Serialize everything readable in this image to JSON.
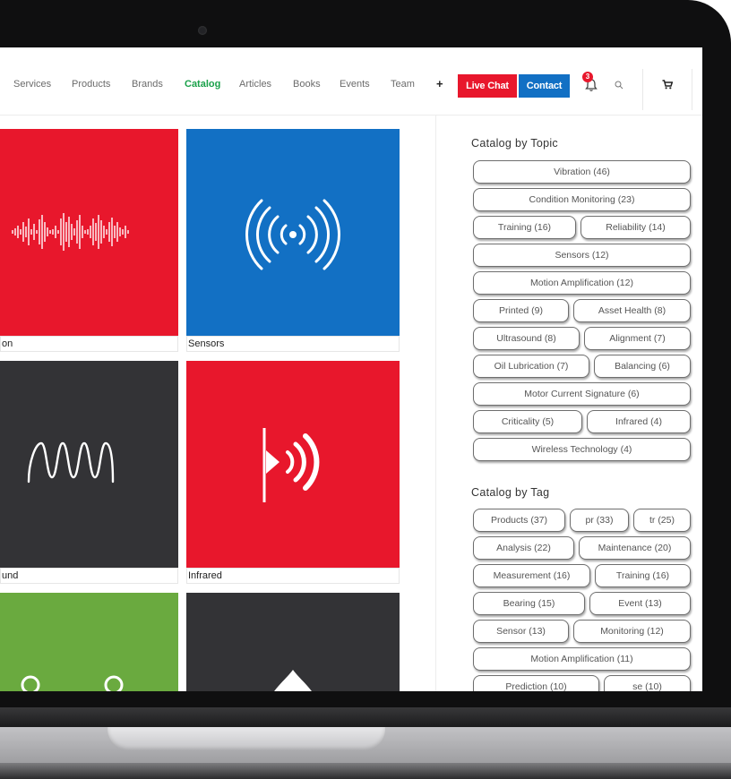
{
  "nav": {
    "items": [
      {
        "label": "Services",
        "active": false
      },
      {
        "label": "Products",
        "active": false
      },
      {
        "label": "Brands",
        "active": false
      },
      {
        "label": "Catalog",
        "active": true
      },
      {
        "label": "Articles",
        "active": false
      },
      {
        "label": "Books",
        "active": false
      },
      {
        "label": "Events",
        "active": false
      },
      {
        "label": "Team",
        "active": false
      }
    ],
    "more": "+",
    "live_chat": "Live Chat",
    "contact": "Contact",
    "notification_count": "3",
    "icons": {
      "bell": "bell-icon",
      "search": "search-icon",
      "cart": "cart-icon"
    }
  },
  "colors": {
    "brand_red": "#e8172c",
    "brand_blue": "#1270c4",
    "nav_active": "#1aa14a",
    "tile_dark": "#333336",
    "tile_green": "#6aaa3f"
  },
  "tiles": [
    {
      "label": "on",
      "icon": "soundwave-icon",
      "color": "#e8172c"
    },
    {
      "label": "Sensors",
      "icon": "wireless-signal-icon",
      "color": "#1270c4"
    },
    {
      "label": "und",
      "icon": "ultrasound-wave-icon",
      "color": "#333336"
    },
    {
      "label": "Infrared",
      "icon": "infrared-icon",
      "color": "#e8172c"
    },
    {
      "label": "",
      "icon": "rings-icon",
      "color": "#6aaa3f"
    },
    {
      "label": "",
      "icon": "oil-drop-icon",
      "color": "#333336"
    }
  ],
  "sidebar": {
    "topic_title": "Catalog by Topic",
    "topics": [
      "Vibration (46)",
      "Condition Monitoring (23)",
      "Training (16)",
      "Reliability (14)",
      "Sensors (12)",
      "Motion Amplification (12)",
      "Printed (9)",
      "Asset Health (8)",
      "Ultrasound (8)",
      "Alignment (7)",
      "Oil Lubrication (7)",
      "Balancing (6)",
      "Motor Current Signature (6)",
      "Criticality (5)",
      "Infrared (4)",
      "Wireless Technology (4)"
    ],
    "tag_title": "Catalog by Tag",
    "tags": [
      "Products (37)",
      "pr (33)",
      "tr (25)",
      "Analysis (22)",
      "Maintenance (20)",
      "Measurement (16)",
      "Training (16)",
      "Bearing (15)",
      "Event (13)",
      "Sensor (13)",
      "Monitoring (12)",
      "Motion Amplification (11)",
      "Prediction (10)",
      "se (10)"
    ]
  }
}
